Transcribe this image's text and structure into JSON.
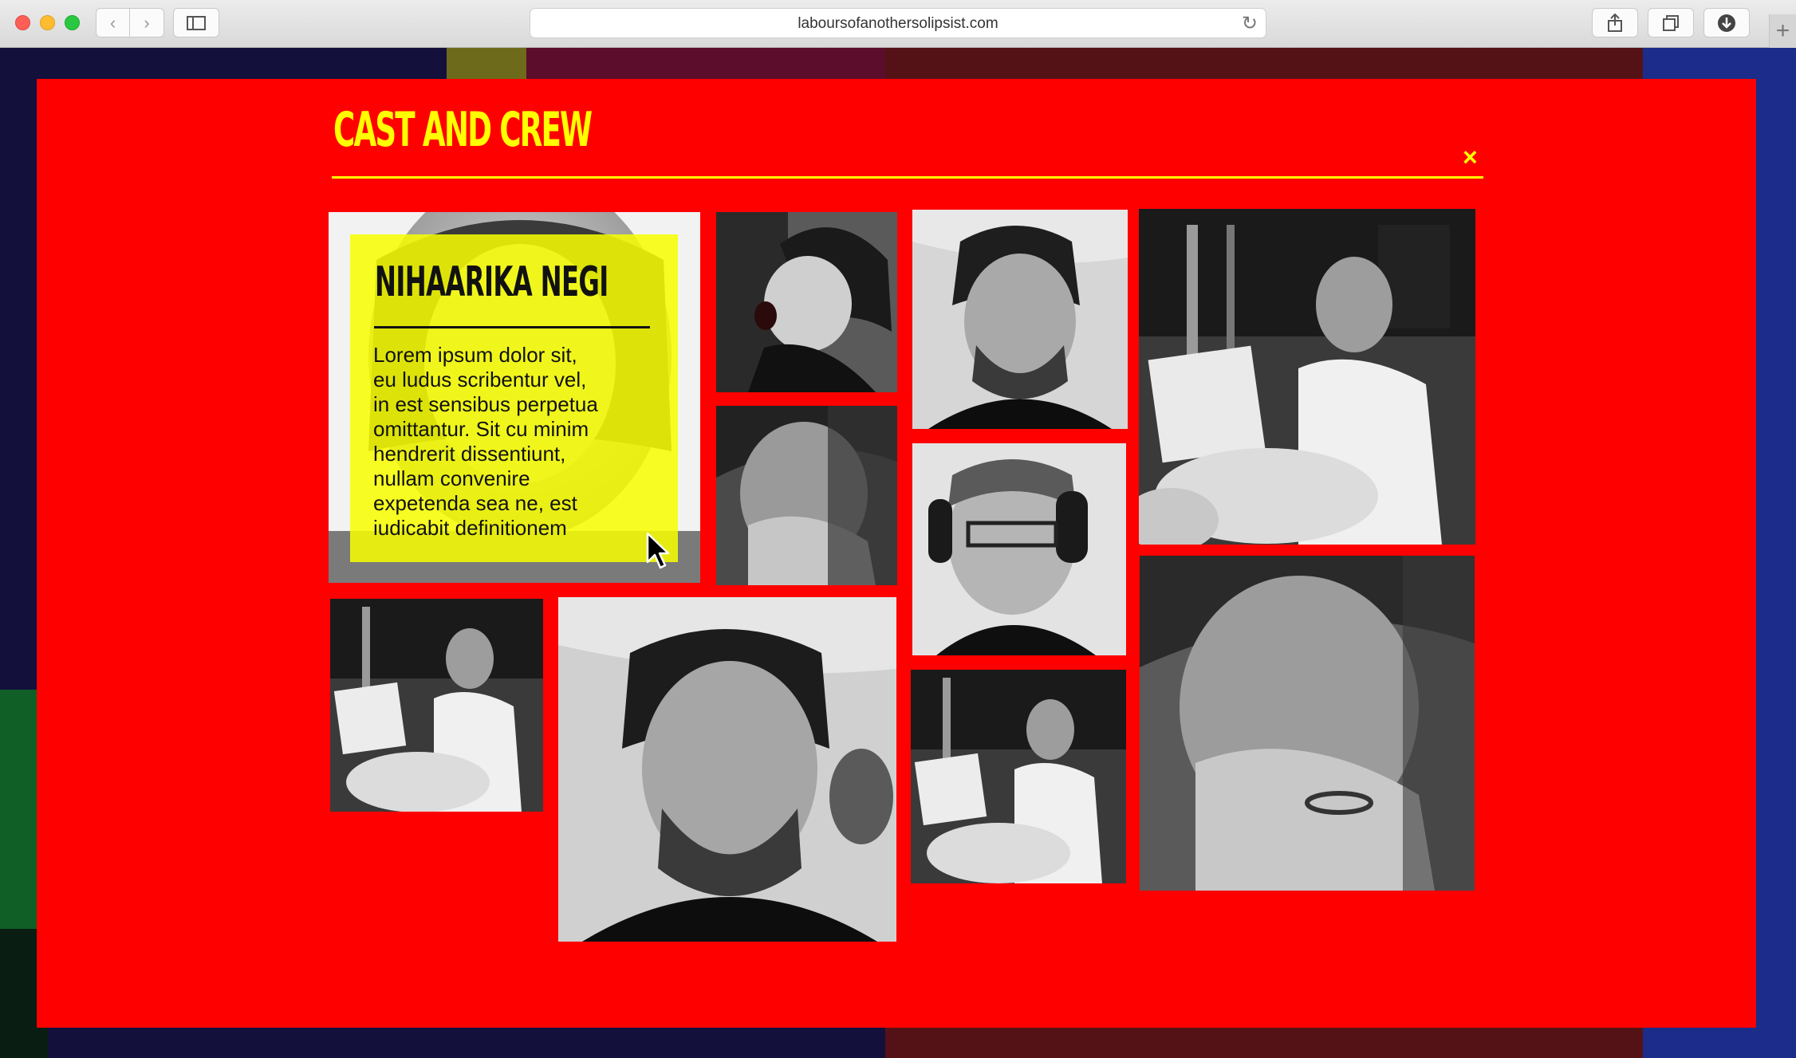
{
  "browser": {
    "url": "laboursofanothersolipsist.com",
    "new_tab_label": "+"
  },
  "modal": {
    "title": "CAST AND CREW",
    "close_label": "×",
    "featured": {
      "name": "NIHAARIKA NEGI",
      "bio": "Lorem ipsum dolor sit,\neu ludus scribentur vel,\nin est sensibus perpetua\n omittantur. Sit cu minim\nhendrerit dissentiunt,\nnullam convenire\nexpetenda sea ne, est\n iudicabit definitionem"
    },
    "photos": [
      {
        "id": "portrait-woman-singing"
      },
      {
        "id": "portrait-man-looking-up"
      },
      {
        "id": "portrait-drummer-headphones-large"
      },
      {
        "id": "portrait-man-hand-on-chin"
      },
      {
        "id": "portrait-man-glasses-headphones"
      },
      {
        "id": "portrait-drummer-headphones-small"
      },
      {
        "id": "portrait-man-looking-up-large"
      },
      {
        "id": "portrait-drummer-headphones-medium"
      },
      {
        "id": "portrait-man-hand-on-chin-large"
      }
    ]
  },
  "colors": {
    "modal_bg": "#fe0000",
    "accent": "#ffff00",
    "card_overlay": "#f8ff00"
  }
}
